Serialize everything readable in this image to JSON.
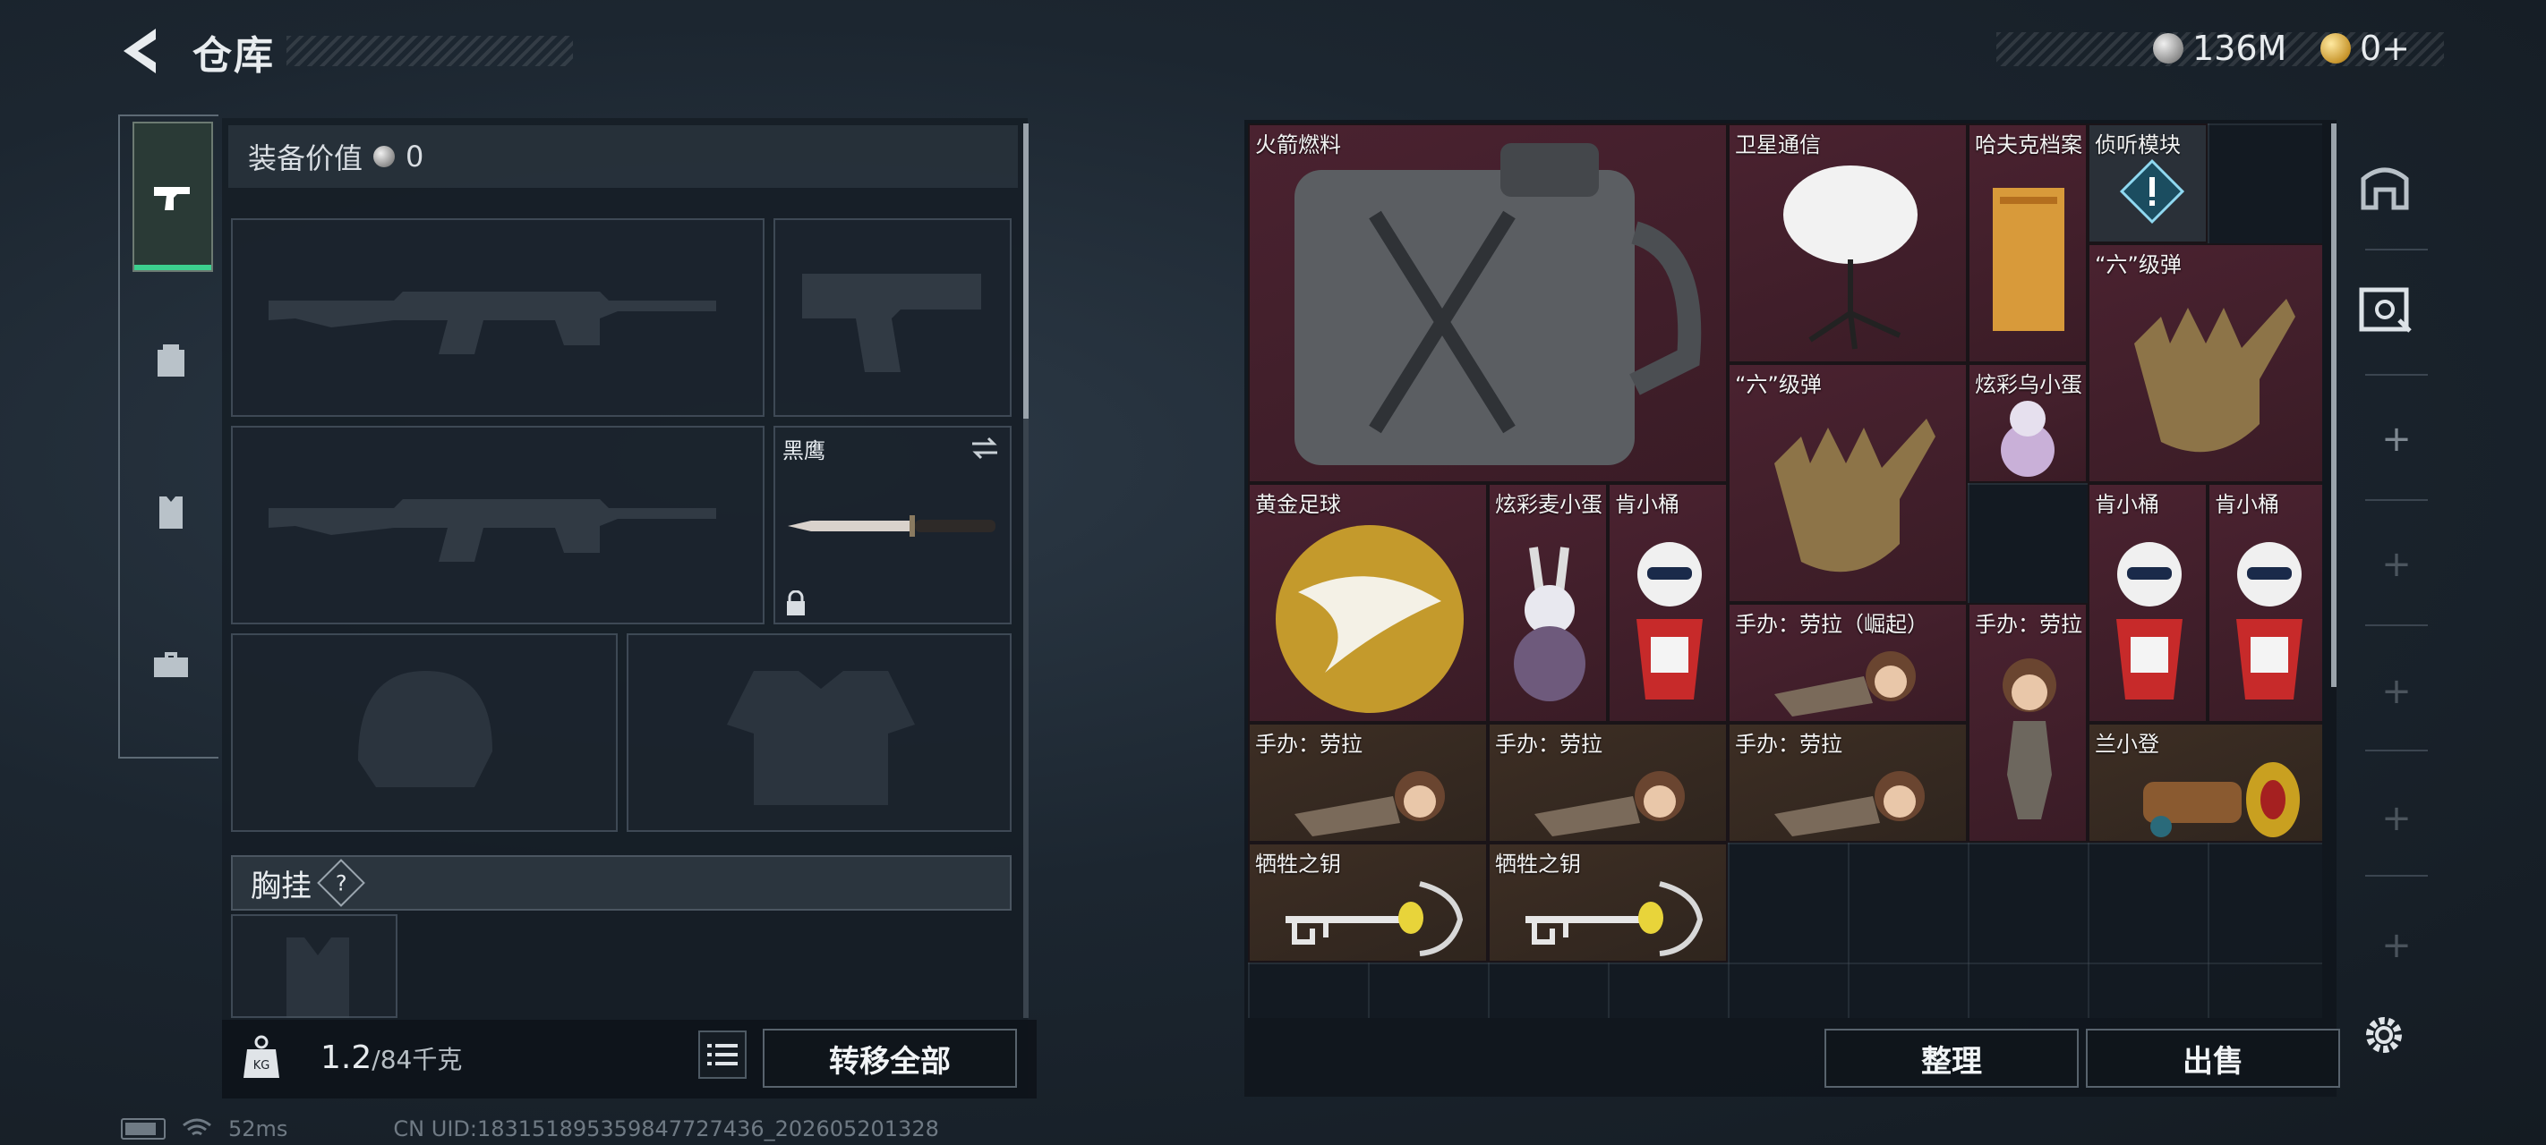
{
  "header": {
    "title": "仓库",
    "currency_silver": "136M",
    "currency_gold": "0+"
  },
  "tabs": [
    {
      "icon": "pistol-icon",
      "active": true
    },
    {
      "icon": "backpack-icon",
      "active": false
    },
    {
      "icon": "vest-icon",
      "active": false
    },
    {
      "icon": "toolbox-icon",
      "active": false
    }
  ],
  "equipment": {
    "value_label": "装备价值",
    "value": "0",
    "melee_label": "黑鹰",
    "chest_label": "胸挂",
    "chest_help": "?",
    "weight_value": "1.2",
    "weight_max": "/84千克",
    "transfer_all": "转移全部"
  },
  "stash": {
    "items": {
      "rocket_fuel": "火箭燃料",
      "satellite": "卫星通信",
      "hafuke": "哈夫克档案",
      "listen_module": "侦听模块",
      "six_ammo_a": "“六”级弹",
      "six_ammo_b": "“六”级弹",
      "egg_bird": "炫彩乌小蛋",
      "gold_ball": "黄金足球",
      "egg_mai": "炫彩麦小蛋",
      "bucket_a": "肯小桶",
      "bucket_b": "肯小桶",
      "bucket_c": "肯小桶",
      "lara_rise": "手办：劳拉（崛起）",
      "lara_a": "手办：劳拉",
      "lara_b": "手办：劳拉",
      "lara_c": "手办：劳拉",
      "lara_d": "手办：劳拉",
      "lan_stool": "兰小登",
      "key_a": "牺牲之钥",
      "key_b": "牺牲之钥"
    },
    "sort_button": "整理",
    "sell_button": "出售"
  },
  "status_bar": {
    "ping": "52ms",
    "uid": "CN UID:18315189535984772743​6_202605201328"
  },
  "colors": {
    "accent_green": "#3ccf8e",
    "rare_red": "#4a2230",
    "rare_brown": "#3d2e24"
  }
}
